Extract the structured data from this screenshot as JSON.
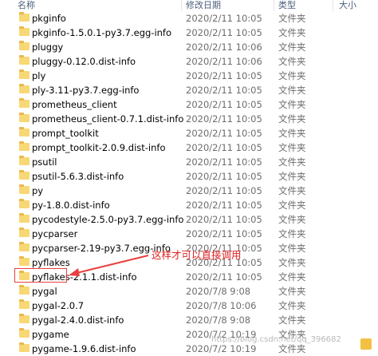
{
  "header": {
    "name_label": "名称",
    "date_label": "修改日期",
    "type_label": "类型",
    "size_label": "大小"
  },
  "rows": [
    {
      "name": "pkginfo",
      "date": "2020/2/11 10:05",
      "type": "文件夹"
    },
    {
      "name": "pkginfo-1.5.0.1-py3.7.egg-info",
      "date": "2020/2/11 10:05",
      "type": "文件夹"
    },
    {
      "name": "pluggy",
      "date": "2020/2/11 10:06",
      "type": "文件夹"
    },
    {
      "name": "pluggy-0.12.0.dist-info",
      "date": "2020/2/11 10:06",
      "type": "文件夹"
    },
    {
      "name": "ply",
      "date": "2020/2/11 10:05",
      "type": "文件夹"
    },
    {
      "name": "ply-3.11-py3.7.egg-info",
      "date": "2020/2/11 10:05",
      "type": "文件夹"
    },
    {
      "name": "prometheus_client",
      "date": "2020/2/11 10:05",
      "type": "文件夹"
    },
    {
      "name": "prometheus_client-0.7.1.dist-info",
      "date": "2020/2/11 10:05",
      "type": "文件夹"
    },
    {
      "name": "prompt_toolkit",
      "date": "2020/2/11 10:05",
      "type": "文件夹"
    },
    {
      "name": "prompt_toolkit-2.0.9.dist-info",
      "date": "2020/2/11 10:05",
      "type": "文件夹"
    },
    {
      "name": "psutil",
      "date": "2020/2/11 10:05",
      "type": "文件夹"
    },
    {
      "name": "psutil-5.6.3.dist-info",
      "date": "2020/2/11 10:05",
      "type": "文件夹"
    },
    {
      "name": "py",
      "date": "2020/2/11 10:05",
      "type": "文件夹"
    },
    {
      "name": "py-1.8.0.dist-info",
      "date": "2020/2/11 10:05",
      "type": "文件夹"
    },
    {
      "name": "pycodestyle-2.5.0-py3.7.egg-info",
      "date": "2020/2/11 10:05",
      "type": "文件夹"
    },
    {
      "name": "pycparser",
      "date": "2020/2/11 10:05",
      "type": "文件夹"
    },
    {
      "name": "pycparser-2.19-py3.7.egg-info",
      "date": "2020/2/11 10:05",
      "type": "文件夹"
    },
    {
      "name": "pyflakes",
      "date": "2020/2/11 10:05",
      "type": "文件夹"
    },
    {
      "name": "pyflakes-2.1.1.dist-info",
      "date": "2020/2/11 10:05",
      "type": "文件夹"
    },
    {
      "name": "pygal",
      "date": "2020/7/8 9:08",
      "type": "文件夹"
    },
    {
      "name": "pygal-2.0.7",
      "date": "2020/7/8 10:06",
      "type": "文件夹"
    },
    {
      "name": "pygal-2.4.0.dist-info",
      "date": "2020/7/8 9:08",
      "type": "文件夹"
    },
    {
      "name": "pygame",
      "date": "2020/7/2 10:19",
      "type": "文件夹"
    },
    {
      "name": "pygame-1.9.6.dist-info",
      "date": "2020/7/2 10:19",
      "type": "文件夹"
    }
  ],
  "annotation": {
    "text": "这样才可以直接调用",
    "color": "#e02020"
  },
  "watermark": "https://blog.csdn.net/qq_396682"
}
